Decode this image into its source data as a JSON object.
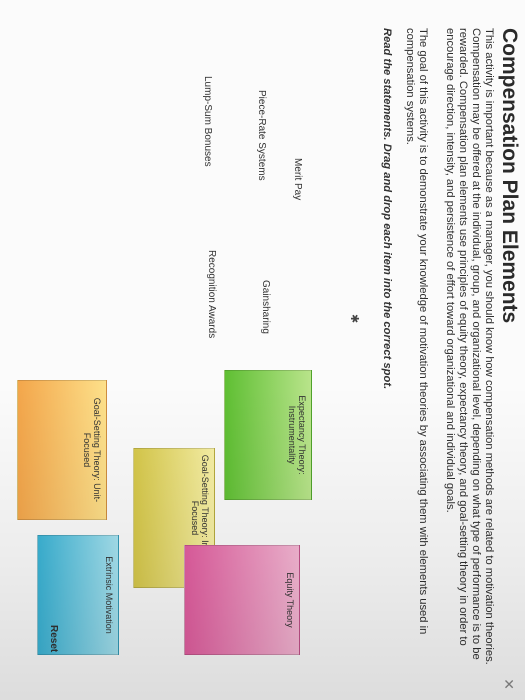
{
  "title": "Compensation Plan Elements",
  "close_label": "✕",
  "paragraphs": [
    "This activity is important because as a manager, you should know how compensation methods are related to motivation theories. Compensation may be offered at the individual, group, and organizational level, depending on what type of performance is to be rewarded. Compensation plan elements use principles of equity theory, expectancy theory, and goal-setting theory in order to encourage direction, intensity, and persistence of effort toward organizational and individual goals.",
    "The goal of this activity is to demonstrate your knowledge of motivation theories by associating them with elements used in compensation systems."
  ],
  "instruction": "Read the statements. Drag and drop each item into the correct spot.",
  "items": {
    "merit_pay": "Merit Pay",
    "piece_rate": "Piece-Rate Systems",
    "gainsharing": "Gainsharing",
    "recognition": "Recognition Awards",
    "lump_sum": "Lump-Sum Bonuses"
  },
  "targets": {
    "expectancy": "Expectancy Theory: Instrumentality",
    "goal_individual": "Goal-Setting Theory: Individual-Focused",
    "goal_unit": "Goal-Setting Theory: Unit-Focused",
    "equity": "Equity Theory",
    "extrinsic": "Extrinsic Motivation"
  },
  "colors": {
    "expectancy": "#5fbf33",
    "goal_individual": "#d6c84a",
    "goal_unit": "#f3a64b",
    "equity": "#e25ea0",
    "extrinsic": "#3bb4d6"
  },
  "reset_label": "Reset",
  "cursor_glyph": "✱"
}
